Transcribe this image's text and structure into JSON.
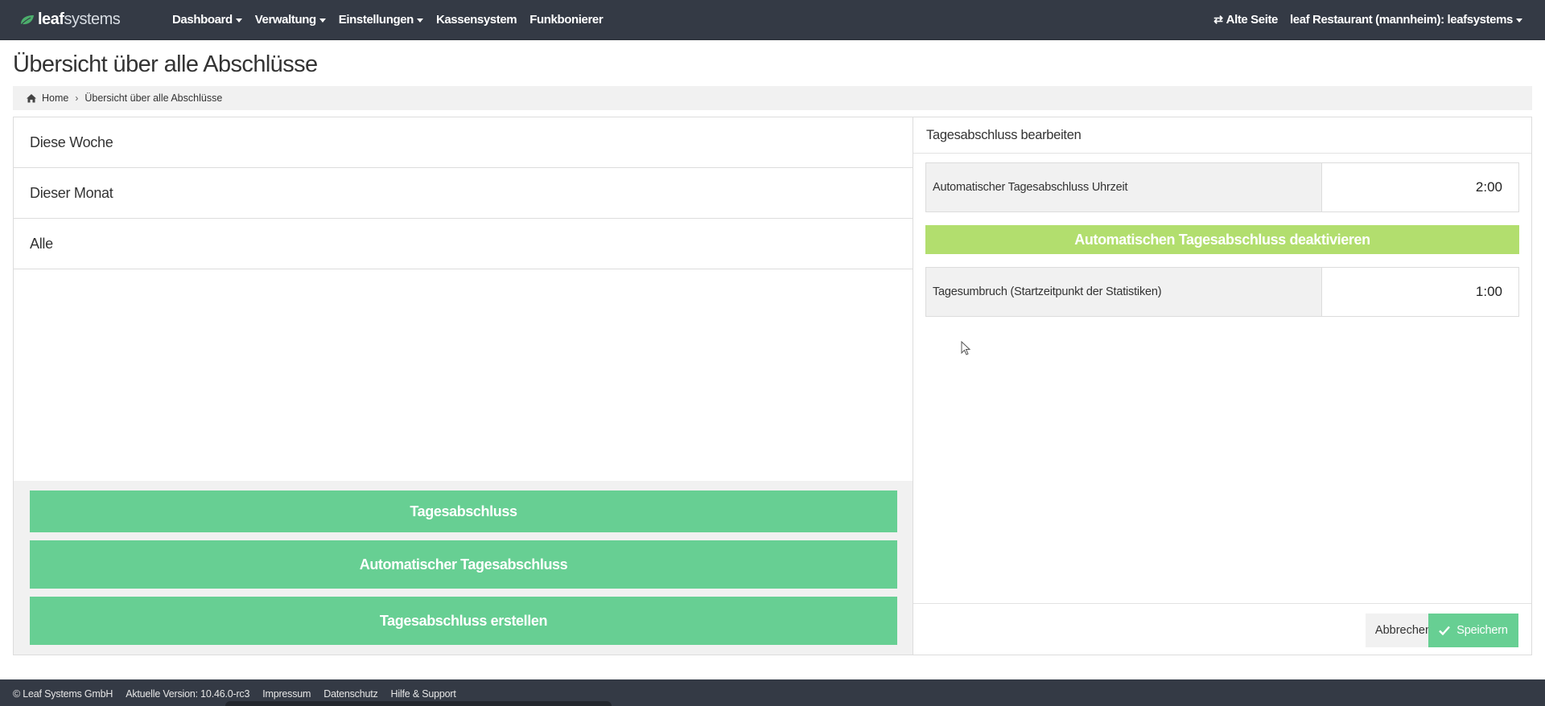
{
  "brand": {
    "part1": "leaf",
    "part2": "systems"
  },
  "nav": {
    "left": [
      {
        "label": "Dashboard",
        "dropdown": true
      },
      {
        "label": "Verwaltung",
        "dropdown": true
      },
      {
        "label": "Einstellungen",
        "dropdown": true
      },
      {
        "label": "Kassensystem",
        "dropdown": false
      },
      {
        "label": "Funkbonierer",
        "dropdown": false
      }
    ],
    "alte_seite": "Alte Seite",
    "account": "leaf Restaurant (mannheim): leafsystems"
  },
  "page": {
    "title": "Übersicht über alle Abschlüsse"
  },
  "breadcrumb": {
    "home": "Home",
    "current": "Übersicht über alle Abschlüsse"
  },
  "periods": [
    "Diese Woche",
    "Dieser Monat",
    "Alle"
  ],
  "left_actions": {
    "btn1": "Tagesabschluss",
    "btn2": "Automatischer Tagesabschluss",
    "btn3": "Tagesabschluss erstellen"
  },
  "edit_panel": {
    "title": "Tagesabschluss bearbeiten",
    "auto_time_label": "Automatischer Tagesabschluss Uhrzeit",
    "auto_time_value": "2:00",
    "deactivate_label": "Automatischen Tagesabschluss deaktivieren",
    "day_break_label": "Tagesumbruch (Startzeitpunkt der Statistiken)",
    "day_break_value": "1:00",
    "cancel_label": "Abbrechen",
    "save_label": "Speichern"
  },
  "footer": {
    "copyright": "© Leaf Systems GmbH",
    "version": "Aktuelle Version: 10.46.0-rc3",
    "impressum": "Impressum",
    "datenschutz": "Datenschutz",
    "hilfe": "Hilfe & Support"
  },
  "colors": {
    "navbar": "#343a45",
    "primary_green": "#67cf93",
    "lime_green": "#b2de6e",
    "brand_leaf": "#4cae6c"
  }
}
